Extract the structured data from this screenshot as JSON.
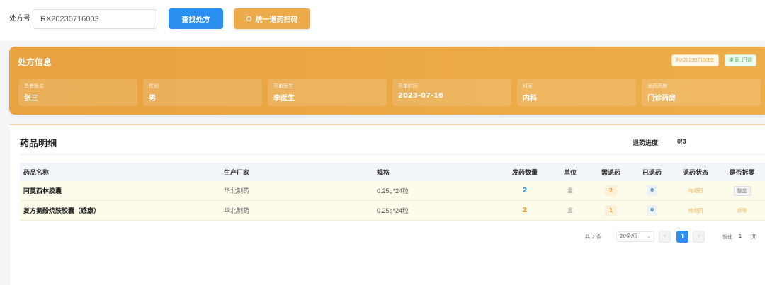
{
  "search": {
    "label": "处方号",
    "value": "RX20230716003",
    "find_button": "查找处方",
    "scan_button": "统一退药扫码"
  },
  "prescription": {
    "title": "处方信息",
    "rx_tag": "RX20230716003",
    "source_tag": "来源: 门诊",
    "fields": [
      {
        "label": "患者姓名",
        "value": "张三"
      },
      {
        "label": "性别",
        "value": "男"
      },
      {
        "label": "开单医生",
        "value": "李医生"
      },
      {
        "label": "开单时间",
        "value": "2023-07-16"
      },
      {
        "label": "科室",
        "value": "内科"
      },
      {
        "label": "发药药房",
        "value": "门诊药房"
      }
    ]
  },
  "detail": {
    "title": "药品明细",
    "progress_label": "退药进度",
    "progress_value": "0/3",
    "columns": [
      "药品名称",
      "生产厂家",
      "规格",
      "发药数量",
      "单位",
      "需退药",
      "已退药",
      "退药状态",
      "是否拆零"
    ],
    "rows": [
      {
        "name": "阿莫西林胶囊",
        "manufacturer": "华北制药",
        "spec": "0.25g*24粒",
        "qty": "2",
        "unit": "盒",
        "need": "2",
        "done": "0",
        "status": "待退药",
        "split": "整盒"
      },
      {
        "name": "复方氨酚烷胺胶囊（感康）",
        "manufacturer": "华北制药",
        "spec": "0.25g*24粒",
        "qty": "2",
        "unit": "盒",
        "need": "1",
        "done": "0",
        "status": "待退药",
        "split": "拆零"
      }
    ]
  },
  "pagination": {
    "total": "共 2 条",
    "page_size": "20条/页",
    "current_page": "1",
    "goto_label": "前往",
    "goto_value": "1",
    "page_suffix": "页"
  },
  "colors": {
    "primary": "#2b8ff0",
    "accent_orange": "#eeae4c"
  }
}
